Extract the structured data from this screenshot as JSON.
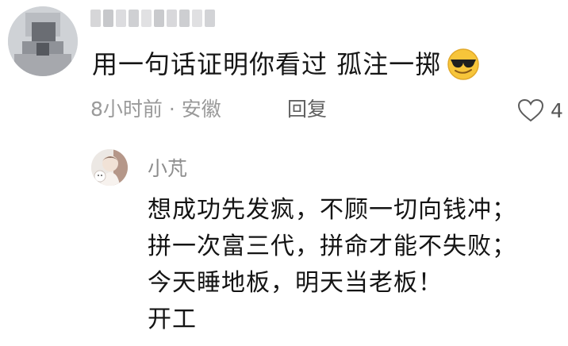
{
  "comment": {
    "username": "",
    "text": "用一句话证明你看过 孤注一掷",
    "emoji": "sunglasses-emoji",
    "time_location": "8小时前 · 安徽",
    "reply_label": "回复",
    "likes": "4"
  },
  "reply": {
    "username": "小芃",
    "lines": [
      "想成功先发疯，不顾一切向钱冲；",
      "拼一次富三代，拼命才能不失败；",
      "今天睡地板，明天当老板！",
      "开工"
    ]
  },
  "colors": {
    "text": "#161616",
    "meta": "#9a9a9a",
    "reply_name": "#8d8d8d",
    "emoji_yellow": "#f7c53a"
  }
}
